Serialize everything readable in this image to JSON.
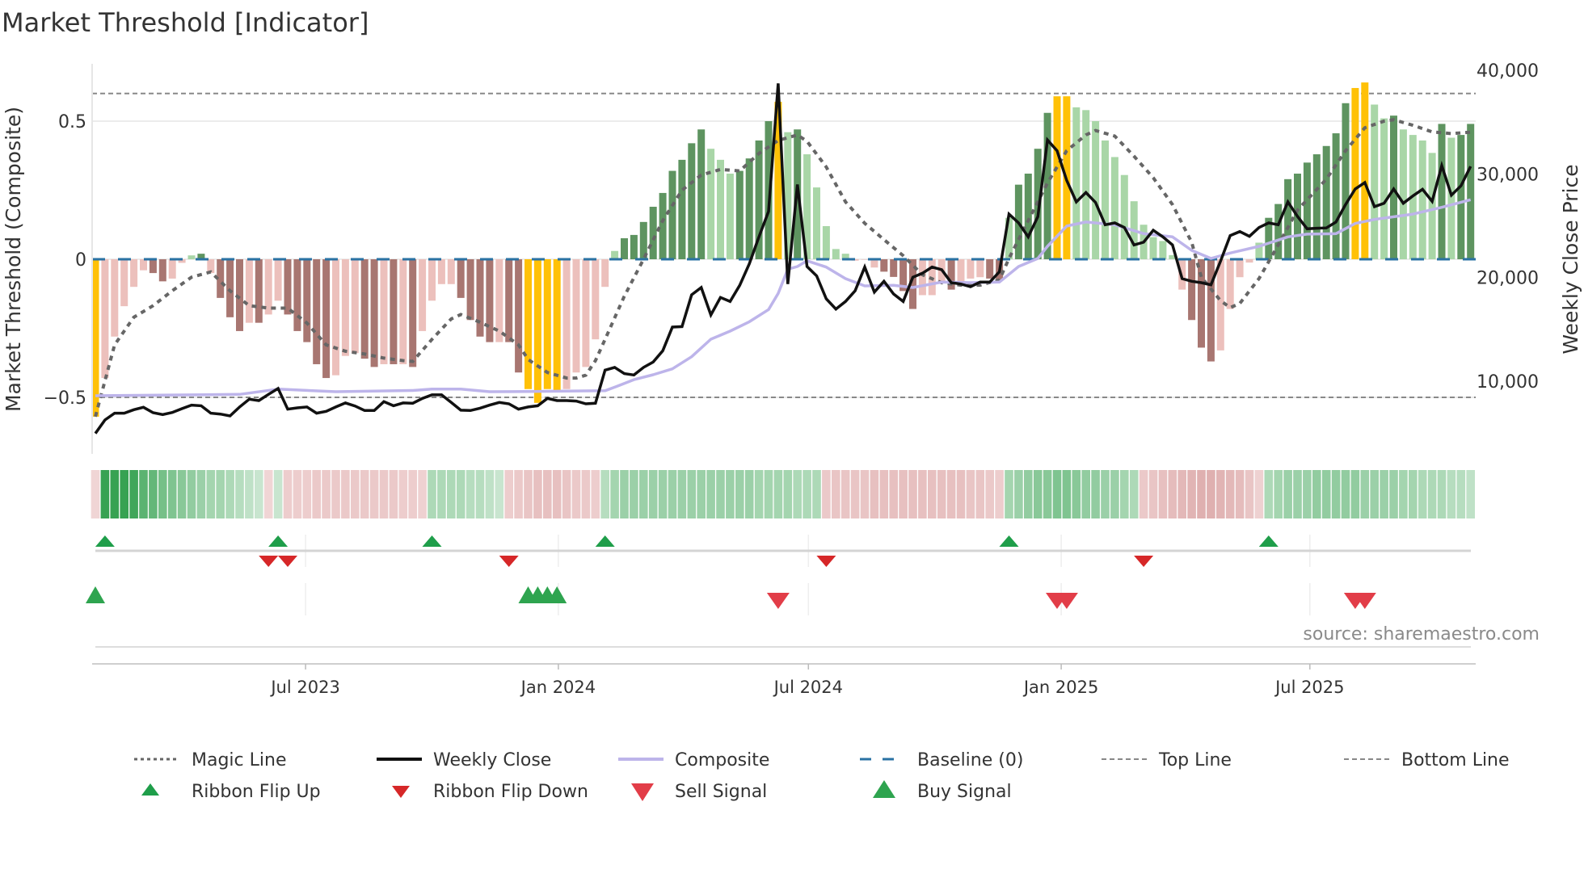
{
  "chart_data": {
    "type": "bar",
    "title": "Market Threshold [Indicator]",
    "ylabel": "Market Threshold (Composite)",
    "y2label": "Weekly Close Price",
    "source": "source: sharemaestro.com",
    "start_date": "2023-01-29",
    "interval_days": 7,
    "ylim": [
      -0.7,
      0.72
    ],
    "yticks": [
      {
        "v": 0.5,
        "label": "0.5"
      },
      {
        "v": 0,
        "label": "0"
      },
      {
        "v": -0.5,
        "label": "−0.5"
      }
    ],
    "y2ticks": [
      {
        "v": 40000,
        "label": "40,000"
      },
      {
        "v": 30000,
        "label": "30,000"
      },
      {
        "v": 20000,
        "label": "20,000"
      },
      {
        "v": 10000,
        "label": "10,000"
      }
    ],
    "xticks": [
      {
        "date": "2023-07-01",
        "label": "Jul 2023"
      },
      {
        "date": "2024-01-01",
        "label": "Jan 2024"
      },
      {
        "date": "2024-07-01",
        "label": "Jul 2024"
      },
      {
        "date": "2025-01-01",
        "label": "Jan 2025"
      },
      {
        "date": "2025-07-01",
        "label": "Jul 2025"
      }
    ],
    "top_line": 0.6,
    "bottom_line": -0.5,
    "baseline": 0,
    "colors": {
      "dg": "#5e9460",
      "lg": "#a9d6a7",
      "dr": "#a87671",
      "lr": "#ecc0bc",
      "y": "#ffc107",
      "magic": "#666666",
      "close": "#111111",
      "composite": "#bdb4ea",
      "baseline": "#2a72a3",
      "threshold": "#888888",
      "flip_up": "#1f9e4a",
      "flip_down": "#d62728",
      "sell": "#e23d48",
      "buy": "#2ea44f"
    },
    "composite_bars": [
      -0.57,
      -0.43,
      -0.28,
      -0.17,
      -0.1,
      -0.04,
      -0.05,
      -0.08,
      -0.07,
      -0.013,
      0.014,
      0.02,
      -0.05,
      -0.14,
      -0.21,
      -0.26,
      -0.23,
      -0.23,
      -0.2,
      -0.15,
      -0.2,
      -0.26,
      -0.3,
      -0.38,
      -0.43,
      -0.42,
      -0.35,
      -0.34,
      -0.36,
      -0.39,
      -0.38,
      -0.38,
      -0.38,
      -0.39,
      -0.26,
      -0.15,
      -0.09,
      -0.09,
      -0.14,
      -0.22,
      -0.28,
      -0.3,
      -0.3,
      -0.3,
      -0.41,
      -0.47,
      -0.52,
      -0.47,
      -0.48,
      -0.47,
      -0.41,
      -0.39,
      -0.29,
      -0.1,
      0.03,
      0.076,
      0.088,
      0.135,
      0.19,
      0.24,
      0.32,
      0.36,
      0.42,
      0.47,
      0.4,
      0.36,
      0.31,
      0.32,
      0.365,
      0.43,
      0.5,
      0.57,
      0.46,
      0.47,
      0.38,
      0.26,
      0.12,
      0.037,
      0.02,
      -0.005,
      0,
      -0.03,
      -0.045,
      -0.064,
      -0.115,
      -0.18,
      -0.13,
      -0.13,
      -0.08,
      -0.11,
      -0.085,
      -0.07,
      -0.065,
      -0.07,
      -0.075,
      0.15,
      0.27,
      0.31,
      0.4,
      0.53,
      0.59,
      0.59,
      0.55,
      0.54,
      0.5,
      0.43,
      0.37,
      0.305,
      0.21,
      0.125,
      0.08,
      0.066,
      0.015,
      -0.11,
      -0.22,
      -0.32,
      -0.37,
      -0.33,
      -0.18,
      -0.065,
      -0.012,
      0.06,
      0.15,
      0.2,
      0.29,
      0.31,
      0.35,
      0.38,
      0.41,
      0.456,
      0.565,
      0.62,
      0.64,
      0.56,
      0.51,
      0.52,
      0.47,
      0.45,
      0.43,
      0.385,
      0.49,
      0.44,
      0.45,
      0.49
    ],
    "bar_types": [
      "y",
      "lr",
      "lr",
      "lr",
      "lr",
      "lr",
      "dr",
      "dr",
      "lr",
      "lr",
      "lg",
      "dg",
      "lr",
      "dr",
      "dr",
      "dr",
      "lr",
      "dr",
      "lr",
      "lr",
      "dr",
      "dr",
      "dr",
      "dr",
      "dr",
      "lr",
      "lr",
      "lr",
      "dr",
      "dr",
      "lr",
      "dr",
      "lr",
      "dr",
      "lr",
      "lr",
      "lr",
      "lr",
      "dr",
      "dr",
      "dr",
      "dr",
      "lr",
      "dr",
      "dr",
      "y",
      "y",
      "y",
      "y",
      "lr",
      "lr",
      "lr",
      "lr",
      "lr",
      "lg",
      "dg",
      "dg",
      "dg",
      "dg",
      "dg",
      "dg",
      "dg",
      "dg",
      "dg",
      "lg",
      "lg",
      "lg",
      "dg",
      "dg",
      "dg",
      "dg",
      "y",
      "lg",
      "dg",
      "lg",
      "lg",
      "lg",
      "lg",
      "lg",
      "lr",
      "lr",
      "lr",
      "dr",
      "dr",
      "dr",
      "dr",
      "lr",
      "lr",
      "lr",
      "dr",
      "lr",
      "lr",
      "lr",
      "dr",
      "dr",
      "lg",
      "dg",
      "dg",
      "dg",
      "dg",
      "y",
      "y",
      "lg",
      "lg",
      "lg",
      "lg",
      "lg",
      "lg",
      "lg",
      "lg",
      "lg",
      "lg",
      "lg",
      "lr",
      "dr",
      "dr",
      "dr",
      "lr",
      "lr",
      "lr",
      "lr",
      "lg",
      "dg",
      "dg",
      "dg",
      "dg",
      "dg",
      "dg",
      "dg",
      "dg",
      "dg",
      "y",
      "y",
      "lg",
      "lg",
      "dg",
      "lg",
      "lg",
      "lg",
      "lg",
      "dg",
      "lg",
      "dg",
      "dg"
    ],
    "weekly_close": [
      4960,
      6260,
      6910,
      6910,
      7250,
      7480,
      6960,
      6780,
      6980,
      7350,
      7690,
      7630,
      6910,
      6830,
      6650,
      7510,
      8260,
      8130,
      8730,
      9300,
      7300,
      7430,
      7510,
      6910,
      7090,
      7510,
      7900,
      7610,
      7170,
      7170,
      8030,
      7630,
      7900,
      7870,
      8340,
      8680,
      8680,
      7950,
      7200,
      7170,
      7400,
      7690,
      7950,
      7820,
      7300,
      7510,
      7630,
      8340,
      8130,
      8130,
      8080,
      7820,
      7870,
      11070,
      11330,
      10730,
      10600,
      11330,
      11850,
      12940,
      15220,
      15270,
      18340,
      19040,
      16390,
      18080,
      17690,
      19250,
      21330,
      23930,
      26390,
      38740,
      19380,
      28990,
      21070,
      20160,
      17950,
      16960,
      17690,
      18730,
      21010,
      18600,
      19640,
      18420,
      17690,
      20030,
      20420,
      21010,
      20760,
      19510,
      19380,
      19120,
      19560,
      19560,
      20550,
      26130,
      25280,
      23930,
      25880,
      33280,
      32240,
      29380,
      27300,
      28210,
      27250,
      25100,
      25280,
      24830,
      23150,
      23410,
      24570,
      23930,
      23150,
      19900,
      19640,
      19510,
      19300,
      21590,
      24050,
      24440,
      23980,
      24830,
      25280,
      25100,
      27300,
      25900,
      24710,
      24760,
      24790,
      25360,
      27050,
      28550,
      29170,
      26840,
      27170,
      28550,
      27170,
      27880,
      28520,
      27360,
      30810,
      27950,
      28860,
      30730
    ],
    "composite_line": [
      [
        0,
        8600
      ],
      [
        15,
        8730
      ],
      [
        19,
        9240
      ],
      [
        25,
        8990
      ],
      [
        33,
        9100
      ],
      [
        35,
        9240
      ],
      [
        38,
        9240
      ],
      [
        41,
        8990
      ],
      [
        45,
        9000
      ],
      [
        53,
        9080
      ],
      [
        54,
        9420
      ],
      [
        56,
        10150
      ],
      [
        58,
        10620
      ],
      [
        60,
        11190
      ],
      [
        62,
        12360
      ],
      [
        64,
        14050
      ],
      [
        66,
        14830
      ],
      [
        68,
        15740
      ],
      [
        70,
        16910
      ],
      [
        71,
        18470
      ],
      [
        72,
        20810
      ],
      [
        73,
        21070
      ],
      [
        74,
        21620
      ],
      [
        76,
        21010
      ],
      [
        78,
        19900
      ],
      [
        80,
        19200
      ],
      [
        83,
        19250
      ],
      [
        85,
        19040
      ],
      [
        88,
        19560
      ],
      [
        91,
        19510
      ],
      [
        94,
        19560
      ],
      [
        96,
        21070
      ],
      [
        98,
        21850
      ],
      [
        99,
        23020
      ],
      [
        101,
        24970
      ],
      [
        103,
        25360
      ],
      [
        106,
        25100
      ],
      [
        109,
        24240
      ],
      [
        112,
        23930
      ],
      [
        114,
        22630
      ],
      [
        116,
        21850
      ],
      [
        118,
        22370
      ],
      [
        121,
        23020
      ],
      [
        124,
        23930
      ],
      [
        126,
        24190
      ],
      [
        129,
        24240
      ],
      [
        131,
        25220
      ],
      [
        133,
        25610
      ],
      [
        137,
        26130
      ],
      [
        140,
        26780
      ],
      [
        143,
        27510
      ]
    ],
    "magic_line": [
      [
        0,
        -0.57
      ],
      [
        2,
        -0.31
      ],
      [
        4,
        -0.21
      ],
      [
        6,
        -0.168
      ],
      [
        8,
        -0.114
      ],
      [
        10,
        -0.065
      ],
      [
        12,
        -0.046
      ],
      [
        14,
        -0.114
      ],
      [
        16,
        -0.168
      ],
      [
        18,
        -0.177
      ],
      [
        20,
        -0.177
      ],
      [
        22,
        -0.231
      ],
      [
        24,
        -0.31
      ],
      [
        26,
        -0.333
      ],
      [
        28,
        -0.343
      ],
      [
        30,
        -0.358
      ],
      [
        32,
        -0.367
      ],
      [
        33,
        -0.37
      ],
      [
        35,
        -0.29
      ],
      [
        37,
        -0.216
      ],
      [
        38,
        -0.2
      ],
      [
        40,
        -0.228
      ],
      [
        42,
        -0.26
      ],
      [
        44,
        -0.31
      ],
      [
        45,
        -0.363
      ],
      [
        47,
        -0.41
      ],
      [
        49,
        -0.43
      ],
      [
        50,
        -0.43
      ],
      [
        51,
        -0.42
      ],
      [
        52,
        -0.367
      ],
      [
        53,
        -0.29
      ],
      [
        55,
        -0.134
      ],
      [
        57,
        0.0
      ],
      [
        59,
        0.14
      ],
      [
        61,
        0.25
      ],
      [
        63,
        0.305
      ],
      [
        65,
        0.325
      ],
      [
        67,
        0.32
      ],
      [
        69,
        0.383
      ],
      [
        71,
        0.43
      ],
      [
        73,
        0.45
      ],
      [
        74,
        0.427
      ],
      [
        76,
        0.334
      ],
      [
        78,
        0.208
      ],
      [
        80,
        0.13
      ],
      [
        82,
        0.071
      ],
      [
        84,
        0.013
      ],
      [
        86,
        -0.056
      ],
      [
        88,
        -0.085
      ],
      [
        90,
        -0.094
      ],
      [
        92,
        -0.094
      ],
      [
        94,
        -0.075
      ],
      [
        95,
        0.003
      ],
      [
        97,
        0.14
      ],
      [
        99,
        0.276
      ],
      [
        101,
        0.393
      ],
      [
        103,
        0.45
      ],
      [
        104,
        0.466
      ],
      [
        106,
        0.446
      ],
      [
        108,
        0.373
      ],
      [
        110,
        0.295
      ],
      [
        112,
        0.198
      ],
      [
        114,
        0.061
      ],
      [
        115,
        -0.065
      ],
      [
        117,
        -0.15
      ],
      [
        118,
        -0.175
      ],
      [
        119,
        -0.16
      ],
      [
        121,
        -0.07
      ],
      [
        123,
        0.052
      ],
      [
        125,
        0.178
      ],
      [
        128,
        0.29
      ],
      [
        130,
        0.393
      ],
      [
        132,
        0.476
      ],
      [
        134,
        0.5
      ],
      [
        135,
        0.505
      ],
      [
        137,
        0.485
      ],
      [
        139,
        0.461
      ],
      [
        141,
        0.455
      ],
      [
        143,
        0.46
      ]
    ],
    "ribbon": [
      -0.15,
      0.95,
      0.95,
      0.95,
      0.9,
      0.75,
      0.7,
      0.6,
      0.55,
      0.5,
      0.45,
      0.4,
      0.35,
      0.35,
      0.3,
      0.25,
      0.2,
      0.15,
      -0.15,
      0.15,
      -0.25,
      -0.25,
      -0.25,
      -0.3,
      -0.3,
      -0.3,
      -0.3,
      -0.3,
      -0.3,
      -0.3,
      -0.3,
      -0.3,
      -0.25,
      -0.25,
      -0.2,
      0.3,
      0.3,
      0.3,
      0.3,
      0.25,
      0.25,
      0.2,
      0.15,
      -0.25,
      -0.3,
      -0.35,
      -0.4,
      -0.4,
      -0.4,
      -0.35,
      -0.3,
      -0.3,
      -0.25,
      0.25,
      0.35,
      0.4,
      0.4,
      0.4,
      0.4,
      0.4,
      0.4,
      0.4,
      0.4,
      0.4,
      0.4,
      0.4,
      0.4,
      0.4,
      0.4,
      0.35,
      0.35,
      0.35,
      0.35,
      0.3,
      0.3,
      0.3,
      -0.3,
      -0.35,
      -0.35,
      -0.35,
      -0.35,
      -0.4,
      -0.4,
      -0.4,
      -0.4,
      -0.4,
      -0.4,
      -0.4,
      -0.4,
      -0.4,
      -0.4,
      -0.35,
      -0.35,
      -0.3,
      -0.25,
      0.35,
      0.4,
      0.45,
      0.5,
      0.5,
      0.55,
      0.55,
      0.5,
      0.45,
      0.45,
      0.4,
      0.4,
      0.35,
      0.3,
      -0.3,
      -0.35,
      -0.4,
      -0.45,
      -0.5,
      -0.55,
      -0.6,
      -0.6,
      -0.55,
      -0.5,
      -0.45,
      -0.35,
      -0.2,
      0.3,
      0.35,
      0.4,
      0.4,
      0.4,
      0.45,
      0.45,
      0.45,
      0.45,
      0.45,
      0.4,
      0.4,
      0.4,
      0.4,
      0.35,
      0.35,
      0.3,
      0.3,
      0.3,
      0.25,
      0.25,
      0.2
    ],
    "ribbon_flip_up": [
      1,
      19,
      35,
      53,
      95,
      122
    ],
    "ribbon_flip_down": [
      18,
      20,
      43,
      76,
      109
    ],
    "buy_signals": [
      0,
      45,
      46,
      47,
      48
    ],
    "sell_signals": [
      71,
      100,
      101,
      131,
      132
    ],
    "legend": [
      {
        "label": "Magic Line",
        "symbol": "dotted"
      },
      {
        "label": "Weekly Close",
        "symbol": "solid-black"
      },
      {
        "label": "Composite",
        "symbol": "solid-lavender"
      },
      {
        "label": "Baseline (0)",
        "symbol": "dashed-blue"
      },
      {
        "label": "Top Line",
        "symbol": "dashed-gray"
      },
      {
        "label": "Bottom Line",
        "symbol": "dashed-gray"
      },
      {
        "label": "Ribbon Flip Up",
        "symbol": "triangle-up-small"
      },
      {
        "label": "Ribbon Flip Down",
        "symbol": "triangle-down-small"
      },
      {
        "label": "Sell Signal",
        "symbol": "triangle-down-large"
      },
      {
        "label": "Buy Signal",
        "symbol": "triangle-up-large"
      }
    ]
  }
}
